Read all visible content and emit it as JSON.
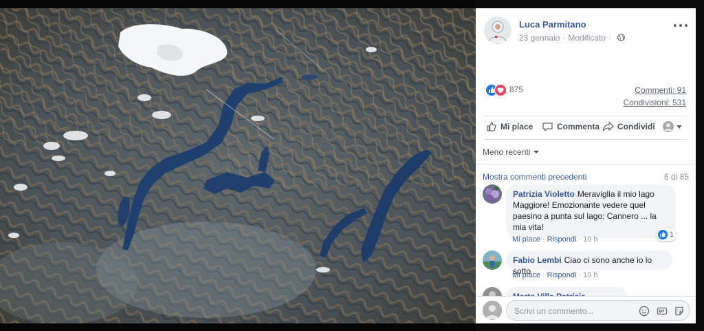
{
  "post": {
    "author": "Luca Parmitano",
    "date": "23 gennaio",
    "edited": "Modificato",
    "reactions_count": "875",
    "comments_count": "Commenti: 91",
    "shares_count": "Condivisioni: 531"
  },
  "actions": {
    "like": "Mi piace",
    "comment": "Commenta",
    "share": "Condividi"
  },
  "sort": {
    "label": "Meno recenti"
  },
  "comments_header": {
    "previous": "Mostra commenti precedenti",
    "count": "6 di 85"
  },
  "comments": [
    {
      "name": "Patrizia Violetto",
      "text": "Meraviglia il mio lago Maggiore! Emozionante vedere quel paesino a punta sul lago: Cannero ... la mia vita!",
      "like": "Mi piace",
      "reply": "Rispondi",
      "time": "10 h",
      "reactions": "1"
    },
    {
      "name": "Fabio Lembi",
      "text": "Ciao ci sono anche io lo sotto",
      "like": "Mi piace",
      "reply": "Rispondi",
      "time": "10 h"
    },
    {
      "name": "Marta Villa Patrizia Parenzian"
    }
  ],
  "composer": {
    "placeholder": "Scrivi un commento..."
  },
  "colors": {
    "link": "#385898",
    "like_blue": "#1877f2",
    "love_red": "#f33e58",
    "lake": "#1f3f6e"
  },
  "icons": [
    "globe-icon",
    "more-icon",
    "like-icon",
    "love-icon",
    "thumb-icon",
    "comment-icon",
    "share-icon",
    "emoji-icon",
    "gif-icon",
    "sticker-icon"
  ]
}
